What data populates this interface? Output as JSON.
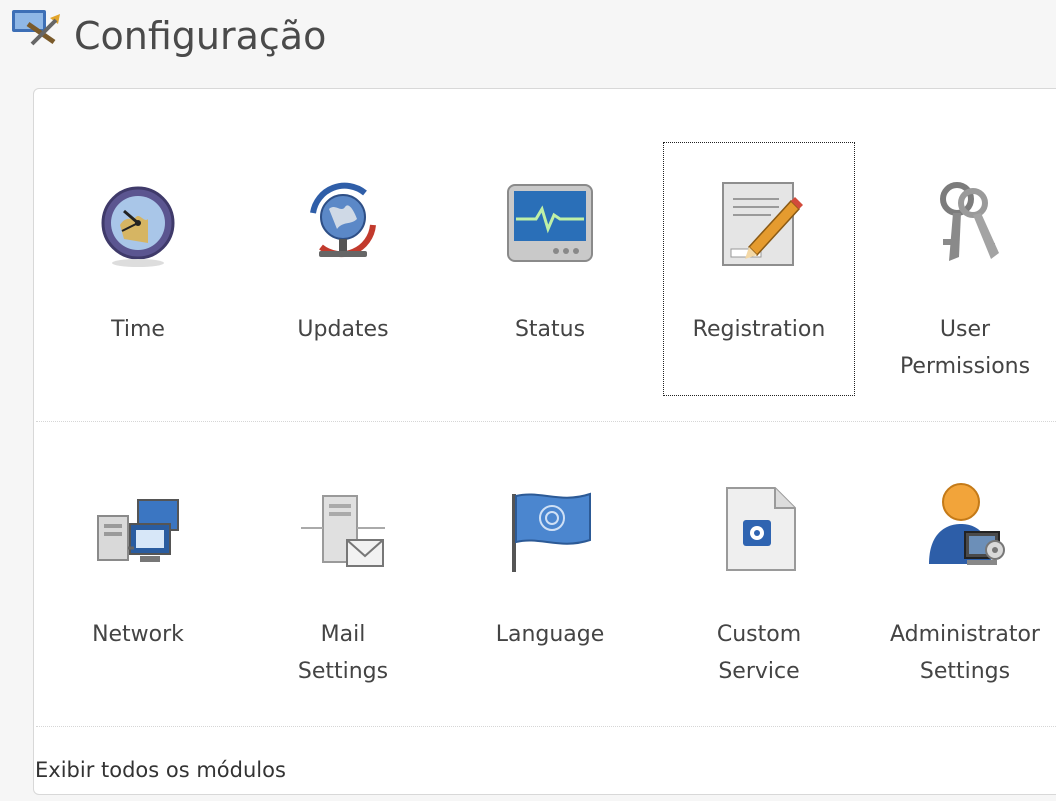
{
  "header": {
    "title": "Configuração",
    "icon": "settings-tools-icon"
  },
  "modules": [
    {
      "label": "Time",
      "icon": "clock-icon"
    },
    {
      "label": "Updates",
      "icon": "globe-update-icon"
    },
    {
      "label": "Status",
      "icon": "monitor-status-icon"
    },
    {
      "label": "Registration",
      "icon": "document-pencil-icon"
    },
    {
      "label": "User\nPermissions",
      "icon": "keys-icon"
    },
    {
      "label": "Network",
      "icon": "network-computers-icon"
    },
    {
      "label": "Mail\nSettings",
      "icon": "mail-server-icon"
    },
    {
      "label": "Language",
      "icon": "flag-icon"
    },
    {
      "label": "Custom\nService",
      "icon": "custom-service-document-icon"
    },
    {
      "label": "Administrator\nSettings",
      "icon": "admin-user-icon"
    }
  ],
  "footer": {
    "link": "Exibir todos os módulos"
  }
}
